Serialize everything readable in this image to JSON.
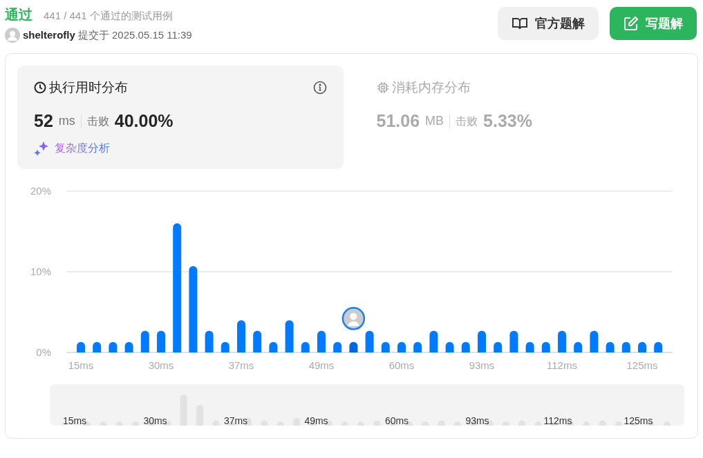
{
  "result": {
    "status": "通过",
    "detail": "441 / 441 个通过的测试用例"
  },
  "submission": {
    "user": "shelterofly",
    "submitted": "提交于 2025.05.15 11:39"
  },
  "buttons": [
    {
      "label": "官方题解",
      "kind": "secondary"
    },
    {
      "label": "写题解",
      "kind": "primary"
    }
  ],
  "panels": [
    {
      "title": "执行用时分布",
      "kind": "time",
      "selected": true,
      "value": "52",
      "unit": "ms",
      "beats_label": "击败",
      "beats": "40.00%",
      "link": "复杂度分析"
    },
    {
      "title": "消耗内存分布",
      "kind": "memory",
      "selected": false,
      "value": "51.06",
      "unit": "MB",
      "beats_label": "击败",
      "beats": "5.33%"
    }
  ],
  "chart": {
    "chart_data": {
      "type": "bar",
      "ylim": [
        0,
        20
      ],
      "yticks": [
        {
          "value": 0,
          "label": "0%"
        },
        {
          "value": 10,
          "label": "10%"
        },
        {
          "value": 20,
          "label": "20%"
        }
      ],
      "categories": [
        "15ms",
        null,
        null,
        null,
        null,
        "30ms",
        null,
        null,
        null,
        null,
        "37ms",
        null,
        null,
        null,
        null,
        "49ms",
        null,
        null,
        null,
        null,
        "60ms",
        null,
        null,
        null,
        null,
        "93ms",
        null,
        null,
        null,
        null,
        "112ms",
        null,
        null,
        null,
        null,
        "125ms",
        null
      ],
      "values": [
        1.3,
        1.3,
        1.3,
        1.3,
        2.7,
        2.7,
        16,
        10.7,
        2.7,
        1.3,
        4,
        2.7,
        1.3,
        4,
        1.3,
        2.7,
        1.3,
        1.3,
        2.7,
        1.3,
        1.3,
        1.3,
        2.7,
        1.3,
        1.3,
        2.7,
        1.3,
        2.7,
        1.3,
        1.3,
        2.7,
        1.3,
        2.7,
        1.3,
        1.3,
        1.3,
        1.3
      ]
    },
    "bars": [
      {
        "selected": false
      },
      {
        "selected": false
      },
      {
        "selected": false
      },
      {
        "selected": false
      },
      {
        "selected": false
      },
      {
        "selected": false
      },
      {
        "selected": false
      },
      {
        "selected": false
      },
      {
        "selected": false
      },
      {
        "selected": false
      },
      {
        "selected": false
      },
      {
        "selected": false
      },
      {
        "selected": false
      },
      {
        "selected": false
      },
      {
        "selected": false
      },
      {
        "selected": false
      },
      {
        "selected": false
      },
      {
        "selected": true
      },
      {
        "selected": false
      },
      {
        "selected": false
      },
      {
        "selected": false
      },
      {
        "selected": false
      },
      {
        "selected": false
      },
      {
        "selected": false
      },
      {
        "selected": false
      },
      {
        "selected": false
      },
      {
        "selected": false
      },
      {
        "selected": false
      },
      {
        "selected": false
      },
      {
        "selected": false
      },
      {
        "selected": false
      },
      {
        "selected": false
      },
      {
        "selected": false
      },
      {
        "selected": false
      },
      {
        "selected": false
      },
      {
        "selected": false
      },
      {
        "selected": false
      }
    ]
  },
  "overview": {
    "labels": [
      "15ms",
      "30ms",
      "37ms",
      "49ms",
      "60ms",
      "93ms",
      "112ms",
      "125ms"
    ]
  }
}
